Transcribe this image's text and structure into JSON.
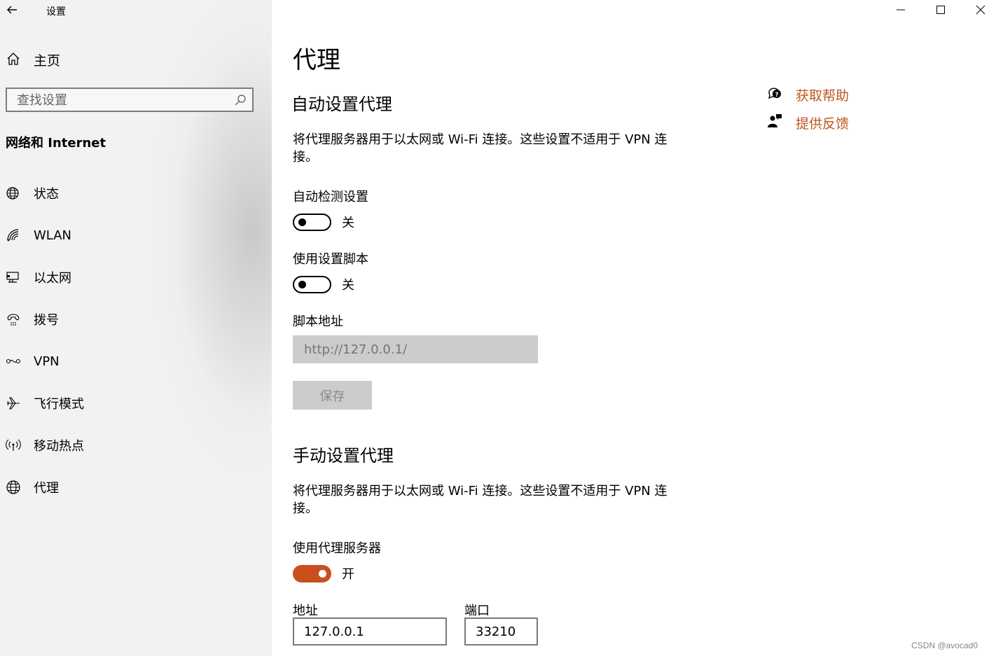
{
  "window": {
    "title": "设置"
  },
  "sidebar": {
    "home_label": "主页",
    "search_placeholder": "查找设置",
    "section_title": "网络和 Internet",
    "items": [
      {
        "label": "状态",
        "icon": "globe-status-icon"
      },
      {
        "label": "WLAN",
        "icon": "wifi-icon"
      },
      {
        "label": "以太网",
        "icon": "ethernet-icon"
      },
      {
        "label": "拨号",
        "icon": "dialup-icon"
      },
      {
        "label": "VPN",
        "icon": "vpn-icon"
      },
      {
        "label": "飞行模式",
        "icon": "airplane-icon"
      },
      {
        "label": "移动热点",
        "icon": "hotspot-icon"
      },
      {
        "label": "代理",
        "icon": "globe-icon"
      }
    ]
  },
  "main": {
    "title": "代理",
    "auto": {
      "heading": "自动设置代理",
      "description": "将代理服务器用于以太网或 Wi-Fi 连接。这些设置不适用于 VPN 连接。",
      "detect_label": "自动检测设置",
      "detect_state": "关",
      "script_label": "使用设置脚本",
      "script_state": "关",
      "script_address_label": "脚本地址",
      "script_address_placeholder": "http://127.0.0.1/",
      "save_label": "保存"
    },
    "manual": {
      "heading": "手动设置代理",
      "description": "将代理服务器用于以太网或 Wi-Fi 连接。这些设置不适用于 VPN 连接。",
      "use_proxy_label": "使用代理服务器",
      "use_proxy_state": "开",
      "address_label": "地址",
      "address_value": "127.0.0.1",
      "port_label": "端口",
      "port_value": "33210"
    },
    "help": {
      "get_help": "获取帮助",
      "feedback": "提供反馈"
    }
  },
  "watermark": "CSDN @avocad0",
  "colors": {
    "accent": "#c94f1d",
    "link": "#c0561f"
  }
}
